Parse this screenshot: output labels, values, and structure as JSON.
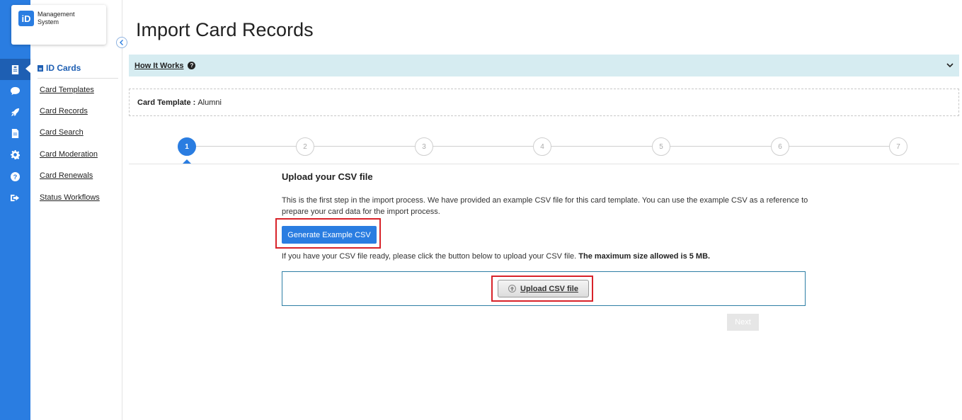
{
  "app": {
    "logo_mark": "iD",
    "logo_line1": "Management",
    "logo_line2": "System"
  },
  "rail": {
    "icons": [
      "id-card-icon",
      "chat-icon",
      "rocket-icon",
      "document-icon",
      "gear-icon",
      "help-icon",
      "logout-icon"
    ],
    "active_index": 0
  },
  "sidebar": {
    "heading": "ID Cards",
    "items": [
      {
        "label": "Card Templates"
      },
      {
        "label": "Card Records"
      },
      {
        "label": "Card Search"
      },
      {
        "label": "Card Moderation"
      },
      {
        "label": "Card Renewals"
      },
      {
        "label": "Status Workflows"
      }
    ]
  },
  "page": {
    "title": "Import Card Records",
    "how_it_works": "How It Works",
    "template_label": "Card Template :",
    "template_value": "Alumni"
  },
  "stepper": {
    "steps": [
      "1",
      "2",
      "3",
      "4",
      "5",
      "6",
      "7"
    ],
    "active": 1
  },
  "step_content": {
    "title": "Upload your CSV file",
    "description": "This is the first step in the import process. We have provided an example CSV file for this card template. You can use the example CSV as a reference to prepare your card data for the import process.",
    "generate_button": "Generate Example CSV",
    "upload_note": "If you have your CSV file ready, please click the button below to upload your CSV file.",
    "upload_note_bold": "The maximum size allowed is 5 MB.",
    "upload_button": "Upload CSV file",
    "next_button": "Next"
  },
  "colors": {
    "primary": "#2a7de1",
    "highlight": "#d8232a",
    "info_bar": "#d6ecf1"
  }
}
